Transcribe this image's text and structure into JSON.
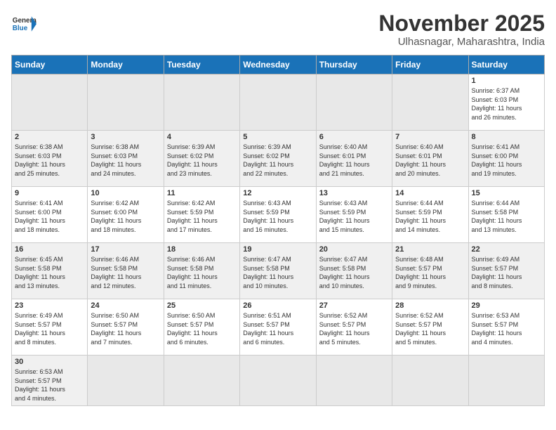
{
  "header": {
    "logo_general": "General",
    "logo_blue": "Blue",
    "month_title": "November 2025",
    "location": "Ulhasnagar, Maharashtra, India"
  },
  "weekdays": [
    "Sunday",
    "Monday",
    "Tuesday",
    "Wednesday",
    "Thursday",
    "Friday",
    "Saturday"
  ],
  "weeks": [
    [
      {
        "day": "",
        "info": ""
      },
      {
        "day": "",
        "info": ""
      },
      {
        "day": "",
        "info": ""
      },
      {
        "day": "",
        "info": ""
      },
      {
        "day": "",
        "info": ""
      },
      {
        "day": "",
        "info": ""
      },
      {
        "day": "1",
        "info": "Sunrise: 6:37 AM\nSunset: 6:03 PM\nDaylight: 11 hours\nand 26 minutes."
      }
    ],
    [
      {
        "day": "2",
        "info": "Sunrise: 6:38 AM\nSunset: 6:03 PM\nDaylight: 11 hours\nand 25 minutes."
      },
      {
        "day": "3",
        "info": "Sunrise: 6:38 AM\nSunset: 6:03 PM\nDaylight: 11 hours\nand 24 minutes."
      },
      {
        "day": "4",
        "info": "Sunrise: 6:39 AM\nSunset: 6:02 PM\nDaylight: 11 hours\nand 23 minutes."
      },
      {
        "day": "5",
        "info": "Sunrise: 6:39 AM\nSunset: 6:02 PM\nDaylight: 11 hours\nand 22 minutes."
      },
      {
        "day": "6",
        "info": "Sunrise: 6:40 AM\nSunset: 6:01 PM\nDaylight: 11 hours\nand 21 minutes."
      },
      {
        "day": "7",
        "info": "Sunrise: 6:40 AM\nSunset: 6:01 PM\nDaylight: 11 hours\nand 20 minutes."
      },
      {
        "day": "8",
        "info": "Sunrise: 6:41 AM\nSunset: 6:00 PM\nDaylight: 11 hours\nand 19 minutes."
      }
    ],
    [
      {
        "day": "9",
        "info": "Sunrise: 6:41 AM\nSunset: 6:00 PM\nDaylight: 11 hours\nand 18 minutes."
      },
      {
        "day": "10",
        "info": "Sunrise: 6:42 AM\nSunset: 6:00 PM\nDaylight: 11 hours\nand 18 minutes."
      },
      {
        "day": "11",
        "info": "Sunrise: 6:42 AM\nSunset: 5:59 PM\nDaylight: 11 hours\nand 17 minutes."
      },
      {
        "day": "12",
        "info": "Sunrise: 6:43 AM\nSunset: 5:59 PM\nDaylight: 11 hours\nand 16 minutes."
      },
      {
        "day": "13",
        "info": "Sunrise: 6:43 AM\nSunset: 5:59 PM\nDaylight: 11 hours\nand 15 minutes."
      },
      {
        "day": "14",
        "info": "Sunrise: 6:44 AM\nSunset: 5:59 PM\nDaylight: 11 hours\nand 14 minutes."
      },
      {
        "day": "15",
        "info": "Sunrise: 6:44 AM\nSunset: 5:58 PM\nDaylight: 11 hours\nand 13 minutes."
      }
    ],
    [
      {
        "day": "16",
        "info": "Sunrise: 6:45 AM\nSunset: 5:58 PM\nDaylight: 11 hours\nand 13 minutes."
      },
      {
        "day": "17",
        "info": "Sunrise: 6:46 AM\nSunset: 5:58 PM\nDaylight: 11 hours\nand 12 minutes."
      },
      {
        "day": "18",
        "info": "Sunrise: 6:46 AM\nSunset: 5:58 PM\nDaylight: 11 hours\nand 11 minutes."
      },
      {
        "day": "19",
        "info": "Sunrise: 6:47 AM\nSunset: 5:58 PM\nDaylight: 11 hours\nand 10 minutes."
      },
      {
        "day": "20",
        "info": "Sunrise: 6:47 AM\nSunset: 5:58 PM\nDaylight: 11 hours\nand 10 minutes."
      },
      {
        "day": "21",
        "info": "Sunrise: 6:48 AM\nSunset: 5:57 PM\nDaylight: 11 hours\nand 9 minutes."
      },
      {
        "day": "22",
        "info": "Sunrise: 6:49 AM\nSunset: 5:57 PM\nDaylight: 11 hours\nand 8 minutes."
      }
    ],
    [
      {
        "day": "23",
        "info": "Sunrise: 6:49 AM\nSunset: 5:57 PM\nDaylight: 11 hours\nand 8 minutes."
      },
      {
        "day": "24",
        "info": "Sunrise: 6:50 AM\nSunset: 5:57 PM\nDaylight: 11 hours\nand 7 minutes."
      },
      {
        "day": "25",
        "info": "Sunrise: 6:50 AM\nSunset: 5:57 PM\nDaylight: 11 hours\nand 6 minutes."
      },
      {
        "day": "26",
        "info": "Sunrise: 6:51 AM\nSunset: 5:57 PM\nDaylight: 11 hours\nand 6 minutes."
      },
      {
        "day": "27",
        "info": "Sunrise: 6:52 AM\nSunset: 5:57 PM\nDaylight: 11 hours\nand 5 minutes."
      },
      {
        "day": "28",
        "info": "Sunrise: 6:52 AM\nSunset: 5:57 PM\nDaylight: 11 hours\nand 5 minutes."
      },
      {
        "day": "29",
        "info": "Sunrise: 6:53 AM\nSunset: 5:57 PM\nDaylight: 11 hours\nand 4 minutes."
      }
    ],
    [
      {
        "day": "30",
        "info": "Sunrise: 6:53 AM\nSunset: 5:57 PM\nDaylight: 11 hours\nand 4 minutes."
      },
      {
        "day": "",
        "info": ""
      },
      {
        "day": "",
        "info": ""
      },
      {
        "day": "",
        "info": ""
      },
      {
        "day": "",
        "info": ""
      },
      {
        "day": "",
        "info": ""
      },
      {
        "day": "",
        "info": ""
      }
    ]
  ]
}
